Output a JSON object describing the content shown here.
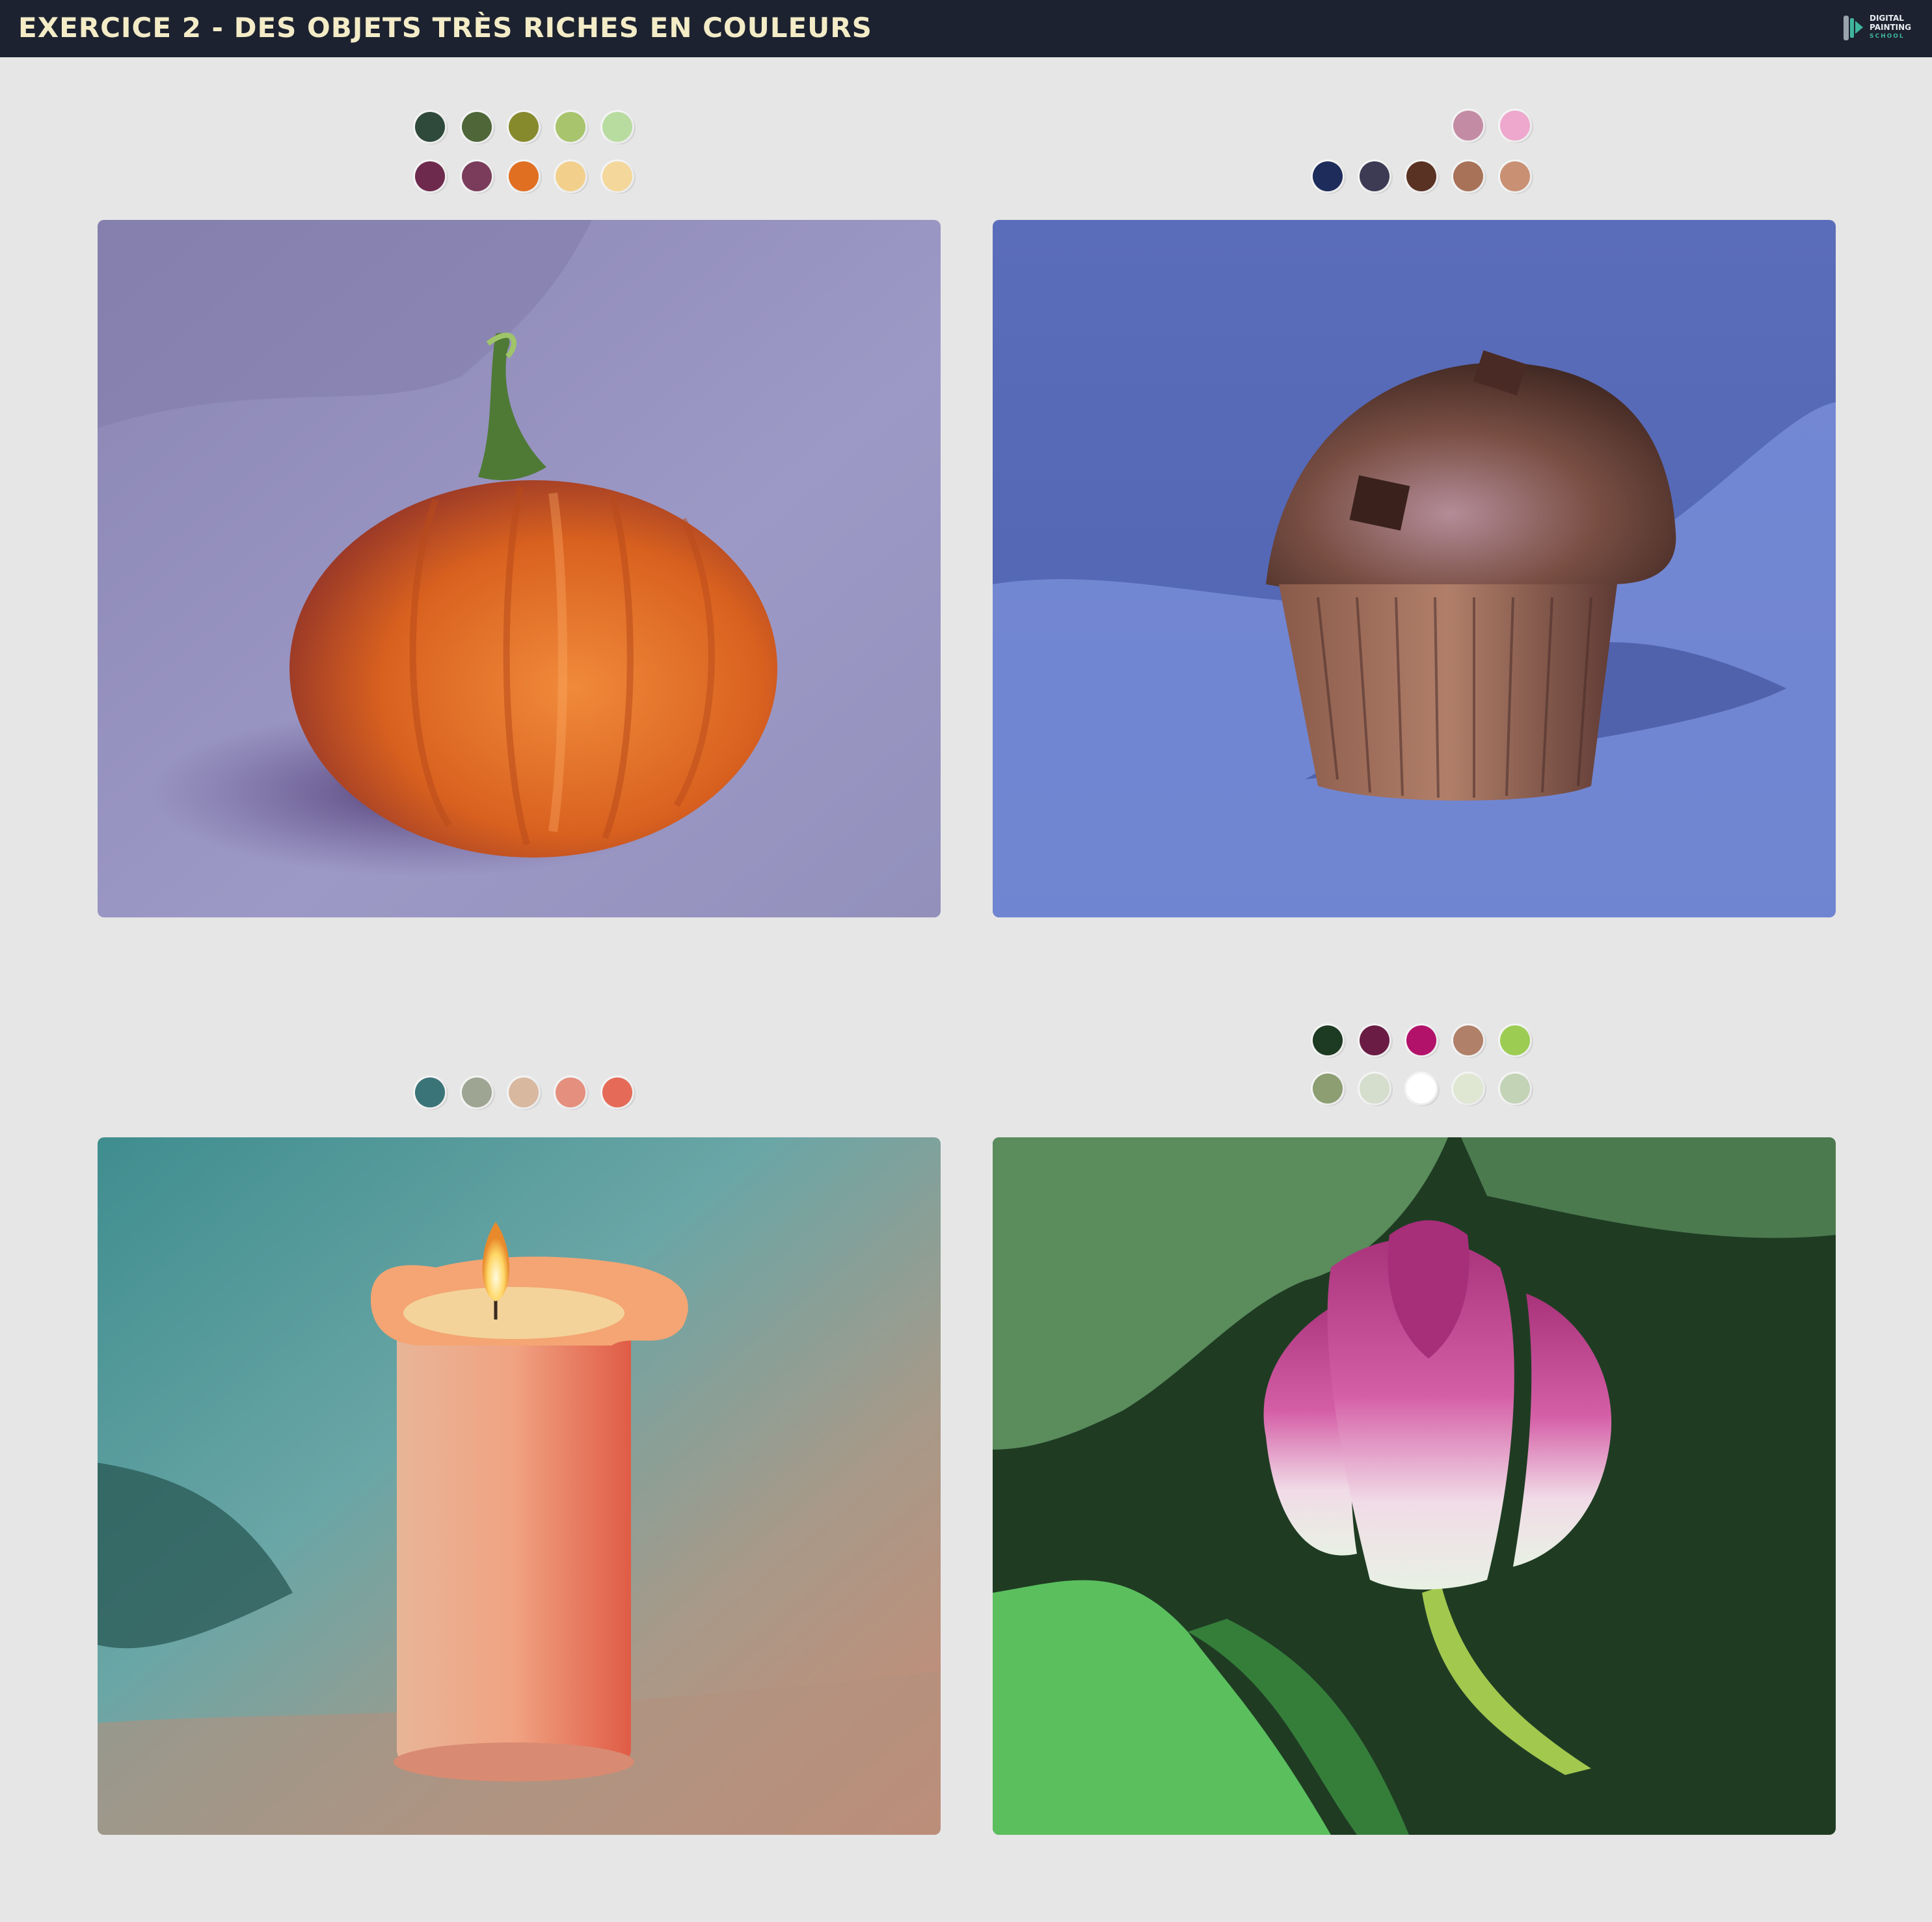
{
  "header": {
    "title": "EXERCICE 2 - DES OBJETS TRÈS RICHES EN COULEURS",
    "logo": {
      "line1": "DIGITAL",
      "line2": "PAINTING",
      "line3": "SCHOOL",
      "icon": "brush-logo-icon"
    }
  },
  "paintings": [
    {
      "name": "pumpkin",
      "palette_rows": [
        [
          "#2f4a3b",
          "#4e6638",
          "#868a2d",
          "#a8c46c",
          "#b8dca0"
        ],
        [
          "#6e2a4c",
          "#7a3c5a",
          "#e06f21",
          "#f2d08c",
          "#f4d79a"
        ]
      ]
    },
    {
      "name": "muffin",
      "palette_rows": [
        [
          "#c48ca4",
          "#eea8cd"
        ],
        [
          "#1d2c5b",
          "#3d3a54",
          "#5a3224",
          "#a77257",
          "#c99073"
        ]
      ]
    },
    {
      "name": "candle",
      "palette_rows": [
        [
          "#3a7478",
          "#9ea592",
          "#d9b8a0",
          "#e58f7e",
          "#e56a58"
        ]
      ]
    },
    {
      "name": "tulip",
      "palette_rows": [
        [
          "#1d3a22",
          "#6a1c44",
          "#b3126b",
          "#b08068",
          "#9ccd52"
        ],
        [
          "#8c9e72",
          "#d5ddcc",
          "#ffffff",
          "#dfe6d2",
          "#c3d3b6"
        ]
      ]
    }
  ]
}
